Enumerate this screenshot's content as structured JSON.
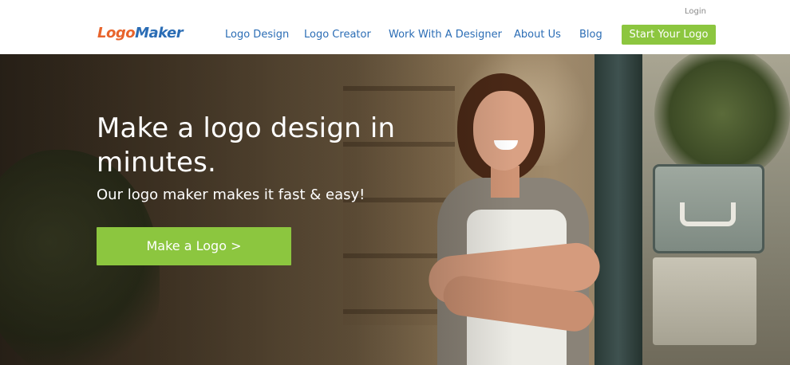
{
  "header": {
    "login_label": "Login",
    "logo": {
      "part1": "Logo",
      "part2": "Maker"
    },
    "nav": [
      {
        "label": "Logo Design"
      },
      {
        "label": "Logo Creator"
      },
      {
        "label": "Work With A Designer"
      },
      {
        "label": "About Us"
      },
      {
        "label": "Blog"
      }
    ],
    "cta_label": "Start Your Logo"
  },
  "hero": {
    "title": "Make a logo design in minutes.",
    "subtitle": "Our logo maker makes it fast & easy!",
    "cta_label": "Make a Logo >"
  },
  "colors": {
    "brand_orange": "#e8642c",
    "brand_blue": "#2b6db5",
    "accent_green": "#8cc63f"
  }
}
